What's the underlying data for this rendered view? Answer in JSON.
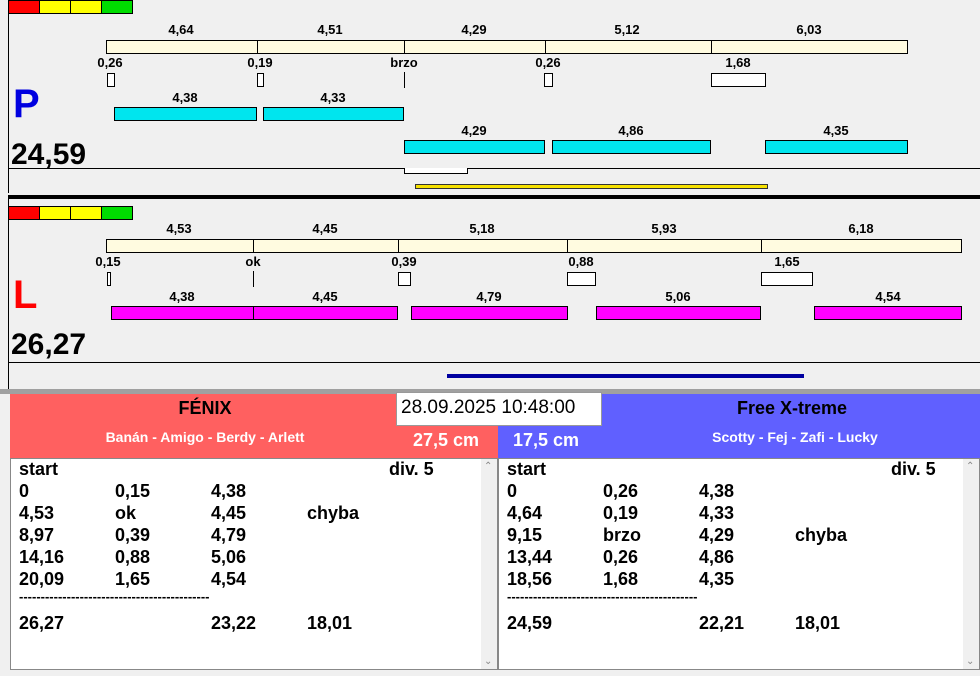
{
  "datetime": "28.09.2025 10:48:00",
  "colors": {
    "red": "#ff0000",
    "yellow": "#ffff00",
    "green": "#00dd00",
    "cream": "#fffbe0",
    "cyan": "#00e5ee",
    "magenta": "#ff00ff",
    "yellow_bar": "#f5e000",
    "blue_bar": "#0000a0",
    "left_header": "#ff6060",
    "right_header": "#6060ff"
  },
  "lane_p": {
    "letter": "P",
    "total": "24,59",
    "times": [
      "4,64",
      "4,51",
      "4,29",
      "5,12",
      "6,03"
    ],
    "reactions": [
      "0,26",
      "0,19",
      "brzo",
      "0,26",
      "1,68"
    ],
    "row_a": [
      "4,38",
      "4,33"
    ],
    "row_b": [
      "4,29",
      "4,86",
      "4,35"
    ]
  },
  "lane_l": {
    "letter": "L",
    "total": "26,27",
    "times": [
      "4,53",
      "4,45",
      "5,18",
      "5,93",
      "6,18"
    ],
    "reactions": [
      "0,15",
      "ok",
      "0,39",
      "0,88",
      "1,65"
    ],
    "row_a": [
      "4,38",
      "4,45",
      "4,79",
      "5,06",
      "4,54"
    ]
  },
  "left_team": {
    "name": "FÉNIX",
    "members": "Banán - Amigo - Berdy - Arlett",
    "height": "27,5 cm",
    "start_label": "start",
    "div_label": "div.  5",
    "rows": [
      [
        "0",
        "0,15",
        "4,38",
        ""
      ],
      [
        "4,53",
        "ok",
        "4,45",
        "chyba"
      ],
      [
        "8,97",
        "0,39",
        "4,79",
        ""
      ],
      [
        "14,16",
        "0,88",
        "5,06",
        ""
      ],
      [
        "20,09",
        "1,65",
        "4,54",
        ""
      ]
    ],
    "separator": "--------------------------------------------",
    "totals": [
      "26,27",
      "",
      "23,22",
      "18,01"
    ]
  },
  "right_team": {
    "name": "Free X-treme",
    "members": "Scotty - Fej - Zafi - Lucky",
    "height": "17,5 cm",
    "start_label": "start",
    "div_label": "div.  5",
    "rows": [
      [
        "0",
        "0,26",
        "4,38",
        ""
      ],
      [
        "4,64",
        "0,19",
        "4,33",
        ""
      ],
      [
        "9,15",
        "brzo",
        "4,29",
        "chyba"
      ],
      [
        "13,44",
        "0,26",
        "4,86",
        ""
      ],
      [
        "18,56",
        "1,68",
        "4,35",
        ""
      ]
    ],
    "separator": "--------------------------------------------",
    "totals": [
      "24,59",
      "",
      "22,21",
      "18,01"
    ]
  }
}
